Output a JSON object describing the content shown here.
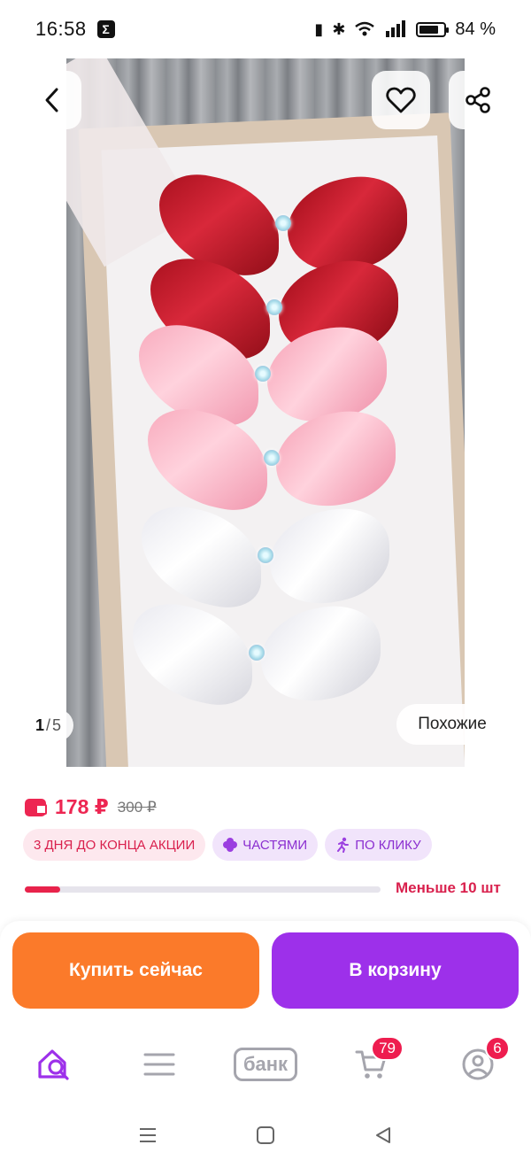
{
  "status_bar": {
    "time": "16:58",
    "battery": "84 %",
    "notification_icon": "sigma-icon"
  },
  "gallery": {
    "current": "1",
    "separator": "/",
    "total": "5",
    "similar_label": "Похожие",
    "icons": {
      "back": "chevron-left-icon",
      "favorite": "heart-icon",
      "share": "share-icon"
    }
  },
  "product": {
    "price": "178 ₽",
    "old_price": "300 ₽",
    "badges": {
      "promo": "3 ДНЯ ДО КОНЦА АКЦИИ",
      "parts": "ЧАСТЯМИ",
      "click": "ПО КЛИКУ"
    },
    "stock_label": "Меньше 10 шт",
    "stock_progress_fraction": 0.1
  },
  "actions": {
    "buy_label": "Купить сейчас",
    "cart_label": "В корзину"
  },
  "bottom_nav": {
    "bank_label": "банк",
    "cart_badge": "79",
    "profile_badge": "6"
  },
  "colors": {
    "accent_purple": "#9d30ea",
    "accent_orange": "#fb7a2a",
    "price_red": "#ed2652"
  }
}
